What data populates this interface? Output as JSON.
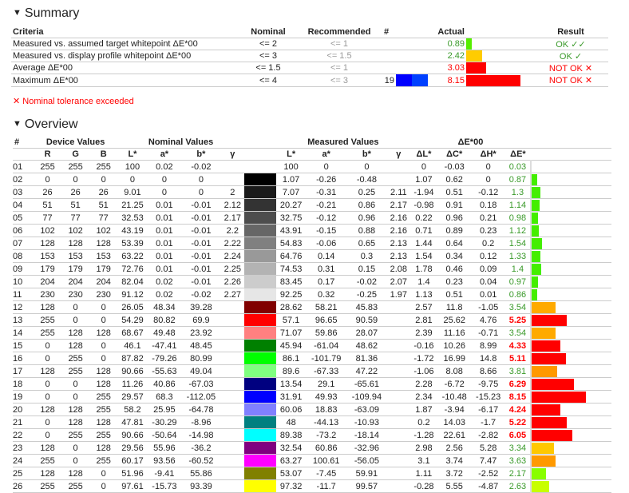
{
  "summary": {
    "title": "Summary",
    "headers": {
      "criteria": "Criteria",
      "nominal": "Nominal",
      "recommended": "Recommended",
      "num": "#",
      "actual": "Actual",
      "result": "Result"
    },
    "rows": [
      {
        "criteria": "Measured vs. assumed target whitepoint ΔE*00",
        "nominal": "<= 2",
        "recommended": "<= 1",
        "num": "",
        "actual": "0.89",
        "result": "OK ✓✓",
        "status": "ok",
        "bar_color": "#55ee00"
      },
      {
        "criteria": "Measured vs. display profile whitepoint ΔE*00",
        "nominal": "<= 3",
        "recommended": "<= 1.5",
        "num": "",
        "actual": "2.42",
        "result": "OK ✓",
        "status": "ok",
        "bar_color": "#ffcc00"
      },
      {
        "criteria": "Average ΔE*00",
        "nominal": "<= 1.5",
        "recommended": "<= 1",
        "num": "",
        "actual": "3.03",
        "result": "NOT OK ✕",
        "status": "bad",
        "bar_color": "#ff0000"
      },
      {
        "criteria": "Maximum ΔE*00",
        "nominal": "<= 4",
        "recommended": "<= 3",
        "num": "19",
        "actual": "8.15",
        "result": "NOT OK ✕",
        "status": "bad",
        "bar_color": "#ff0000",
        "swatch": [
          "#0000ff",
          "#0040ff"
        ]
      }
    ],
    "note": "✕ Nominal tolerance exceeded"
  },
  "overview": {
    "title": "Overview",
    "group_headers": {
      "num": "#",
      "device": "Device Values",
      "nominal": "Nominal Values",
      "measured": "Measured Values",
      "delta": "ΔE*00"
    },
    "col_headers": [
      "R",
      "G",
      "B",
      "L*",
      "a*",
      "b*",
      "γ",
      "L*",
      "a*",
      "b*",
      "γ",
      "ΔL*",
      "ΔC*",
      "ΔH*",
      "ΔE*"
    ],
    "rows": [
      [
        "01",
        "255",
        "255",
        "255",
        "100",
        "0.02",
        "-0.02",
        "",
        "100",
        "0",
        "0",
        "",
        "0",
        "-0.03",
        "0",
        "0.03"
      ],
      [
        "02",
        "0",
        "0",
        "0",
        "0",
        "0",
        "0",
        "",
        "1.07",
        "-0.26",
        "-0.48",
        "",
        "1.07",
        "0.62",
        "0",
        "0.87"
      ],
      [
        "03",
        "26",
        "26",
        "26",
        "9.01",
        "0",
        "0",
        "2",
        "7.07",
        "-0.31",
        "0.25",
        "2.11",
        "-1.94",
        "0.51",
        "-0.12",
        "1.3"
      ],
      [
        "04",
        "51",
        "51",
        "51",
        "21.25",
        "0.01",
        "-0.01",
        "2.12",
        "20.27",
        "-0.21",
        "0.86",
        "2.17",
        "-0.98",
        "0.91",
        "0.18",
        "1.14"
      ],
      [
        "05",
        "77",
        "77",
        "77",
        "32.53",
        "0.01",
        "-0.01",
        "2.17",
        "32.75",
        "-0.12",
        "0.96",
        "2.16",
        "0.22",
        "0.96",
        "0.21",
        "0.98"
      ],
      [
        "06",
        "102",
        "102",
        "102",
        "43.19",
        "0.01",
        "-0.01",
        "2.2",
        "43.91",
        "-0.15",
        "0.88",
        "2.16",
        "0.71",
        "0.89",
        "0.23",
        "1.12"
      ],
      [
        "07",
        "128",
        "128",
        "128",
        "53.39",
        "0.01",
        "-0.01",
        "2.22",
        "54.83",
        "-0.06",
        "0.65",
        "2.13",
        "1.44",
        "0.64",
        "0.2",
        "1.54"
      ],
      [
        "08",
        "153",
        "153",
        "153",
        "63.22",
        "0.01",
        "-0.01",
        "2.24",
        "64.76",
        "0.14",
        "0.3",
        "2.13",
        "1.54",
        "0.34",
        "0.12",
        "1.33"
      ],
      [
        "09",
        "179",
        "179",
        "179",
        "72.76",
        "0.01",
        "-0.01",
        "2.25",
        "74.53",
        "0.31",
        "0.15",
        "2.08",
        "1.78",
        "0.46",
        "0.09",
        "1.4"
      ],
      [
        "10",
        "204",
        "204",
        "204",
        "82.04",
        "0.02",
        "-0.01",
        "2.26",
        "83.45",
        "0.17",
        "-0.02",
        "2.07",
        "1.4",
        "0.23",
        "0.04",
        "0.97"
      ],
      [
        "11",
        "230",
        "230",
        "230",
        "91.12",
        "0.02",
        "-0.02",
        "2.27",
        "92.25",
        "0.32",
        "-0.25",
        "1.97",
        "1.13",
        "0.51",
        "0.01",
        "0.86"
      ],
      [
        "12",
        "128",
        "0",
        "0",
        "26.05",
        "48.34",
        "39.28",
        "",
        "28.62",
        "58.21",
        "45.83",
        "",
        "2.57",
        "11.8",
        "-1.05",
        "3.54"
      ],
      [
        "13",
        "255",
        "0",
        "0",
        "54.29",
        "80.82",
        "69.9",
        "",
        "57.1",
        "96.65",
        "90.59",
        "",
        "2.81",
        "25.62",
        "4.76",
        "5.25"
      ],
      [
        "14",
        "255",
        "128",
        "128",
        "68.67",
        "49.48",
        "23.92",
        "",
        "71.07",
        "59.86",
        "28.07",
        "",
        "2.39",
        "11.16",
        "-0.71",
        "3.54"
      ],
      [
        "15",
        "0",
        "128",
        "0",
        "46.1",
        "-47.41",
        "48.45",
        "",
        "45.94",
        "-61.04",
        "48.62",
        "",
        "-0.16",
        "10.26",
        "8.99",
        "4.33"
      ],
      [
        "16",
        "0",
        "255",
        "0",
        "87.82",
        "-79.26",
        "80.99",
        "",
        "86.1",
        "-101.79",
        "81.36",
        "",
        "-1.72",
        "16.99",
        "14.8",
        "5.11"
      ],
      [
        "17",
        "128",
        "255",
        "128",
        "90.66",
        "-55.63",
        "49.04",
        "",
        "89.6",
        "-67.33",
        "47.22",
        "",
        "-1.06",
        "8.08",
        "8.66",
        "3.81"
      ],
      [
        "18",
        "0",
        "0",
        "128",
        "11.26",
        "40.86",
        "-67.03",
        "",
        "13.54",
        "29.1",
        "-65.61",
        "",
        "2.28",
        "-6.72",
        "-9.75",
        "6.29"
      ],
      [
        "19",
        "0",
        "0",
        "255",
        "29.57",
        "68.3",
        "-112.05",
        "",
        "31.91",
        "49.93",
        "-109.94",
        "",
        "2.34",
        "-10.48",
        "-15.23",
        "8.15"
      ],
      [
        "20",
        "128",
        "128",
        "255",
        "58.2",
        "25.95",
        "-64.78",
        "",
        "60.06",
        "18.83",
        "-63.09",
        "",
        "1.87",
        "-3.94",
        "-6.17",
        "4.24"
      ],
      [
        "21",
        "0",
        "128",
        "128",
        "47.81",
        "-30.29",
        "-8.96",
        "",
        "48",
        "-44.13",
        "-10.93",
        "",
        "0.2",
        "14.03",
        "-1.7",
        "5.22"
      ],
      [
        "22",
        "0",
        "255",
        "255",
        "90.66",
        "-50.64",
        "-14.98",
        "",
        "89.38",
        "-73.2",
        "-18.14",
        "",
        "-1.28",
        "22.61",
        "-2.82",
        "6.05"
      ],
      [
        "23",
        "128",
        "0",
        "128",
        "29.56",
        "55.96",
        "-36.2",
        "",
        "32.54",
        "60.86",
        "-32.96",
        "",
        "2.98",
        "2.56",
        "5.28",
        "3.34"
      ],
      [
        "24",
        "255",
        "0",
        "255",
        "60.17",
        "93.56",
        "-60.52",
        "",
        "63.27",
        "100.61",
        "-56.05",
        "",
        "3.1",
        "3.74",
        "7.47",
        "3.63"
      ],
      [
        "25",
        "128",
        "128",
        "0",
        "51.96",
        "-9.41",
        "55.86",
        "",
        "53.07",
        "-7.45",
        "59.91",
        "",
        "1.11",
        "3.72",
        "-2.52",
        "2.17"
      ],
      [
        "26",
        "255",
        "255",
        "0",
        "97.61",
        "-15.73",
        "93.39",
        "",
        "97.32",
        "-11.7",
        "99.57",
        "",
        "-0.28",
        "5.55",
        "-4.87",
        "2.63"
      ]
    ]
  },
  "colors": {
    "ok_text": "#3a9a2a",
    "bad_text": "#ff0000"
  }
}
